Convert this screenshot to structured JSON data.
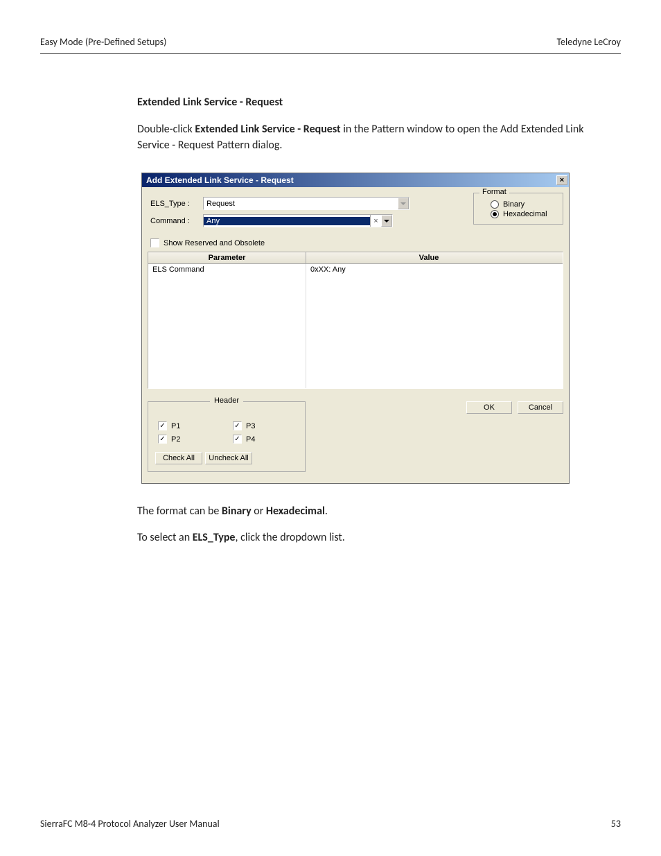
{
  "header": {
    "left": "Easy Mode (Pre-Defined Setups)",
    "right": "Teledyne  LeCroy"
  },
  "section": {
    "title": "Extended Link Service - Request",
    "p1_a": "Double-click ",
    "p1_b": "Extended Link Service - Request",
    "p1_c": " in the Pattern window to open the Add Extended Link Service - Request  Pattern dialog.",
    "p2_a": "The format can be ",
    "p2_b": "Binary",
    "p2_c": " or ",
    "p2_d": "Hexadecimal",
    "p2_e": ".",
    "p3_a": "To select an ",
    "p3_b": "ELS_Type",
    "p3_c": ", click the dropdown list."
  },
  "dialog": {
    "title": "Add Extended Link Service - Request",
    "elsTypeLabel": "ELS_Type :",
    "elsTypeValue": "Request",
    "commandLabel": "Command :",
    "commandValue": "Any",
    "formatLegend": "Format",
    "fmtBinary": "Binary",
    "fmtHex": "Hexadecimal",
    "showReserved": "Show Reserved and Obsolete",
    "paramHeader": "Parameter",
    "valueHeader": "Value",
    "row1Param": "ELS Command",
    "row1Value": "0xXX: Any",
    "headerGroup": "Header",
    "ports": [
      "P1",
      "P2",
      "P3",
      "P4"
    ],
    "checkAll": "Check All",
    "uncheckAll": "Uncheck All",
    "ok": "OK",
    "cancel": "Cancel"
  },
  "footer": {
    "left": "SierraFC M8-4 Protocol Analyzer User Manual",
    "right": "53"
  }
}
